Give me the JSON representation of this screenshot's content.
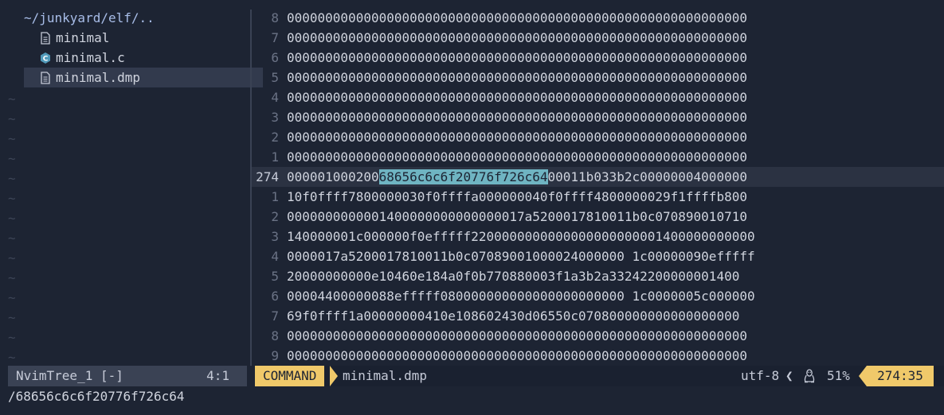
{
  "tree": {
    "root": "~/junkyard/elf/..",
    "items": [
      {
        "label": "minimal",
        "icon": "file-icon"
      },
      {
        "label": "minimal.c",
        "icon": "c-language-icon"
      },
      {
        "label": "minimal.dmp",
        "icon": "file-icon",
        "selected": true
      }
    ],
    "tilde": "~"
  },
  "editor": {
    "lines": [
      {
        "ln": "8",
        "text": "000000000000000000000000000000000000000000000000000000000000"
      },
      {
        "ln": "7",
        "text": "000000000000000000000000000000000000000000000000000000000000"
      },
      {
        "ln": "6",
        "text": "000000000000000000000000000000000000000000000000000000000000"
      },
      {
        "ln": "5",
        "text": "000000000000000000000000000000000000000000000000000000000000"
      },
      {
        "ln": "4",
        "text": "000000000000000000000000000000000000000000000000000000000000"
      },
      {
        "ln": "3",
        "text": "000000000000000000000000000000000000000000000000000000000000"
      },
      {
        "ln": "2",
        "text": "000000000000000000000000000000000000000000000000000000000000"
      },
      {
        "ln": "1",
        "text": "000000000000000000000000000000000000000000000000000000000000"
      },
      {
        "ln": "274",
        "pre": "000001000200",
        "match": "68656c6c6f20776f726c64",
        "post": "00011b033b2c00000004000000",
        "current": true
      },
      {
        "ln": "1",
        "text": "10f0ffff7800000030f0ffffa000000040f0ffff4800000029f1ffffb800"
      },
      {
        "ln": "2",
        "text": "0000000000001400000000000000017a5200017810011b0c070890010710"
      },
      {
        "ln": "3",
        "text": "140000001c000000f0efffff2200000000000000000000001400000000000"
      },
      {
        "ln": "4",
        "text": "0000017a5200017810011b0c07089001000024000000 1c00000090efffff"
      },
      {
        "ln": "5",
        "text": "20000000000e10460e184a0f0b770880003f1a3b2a33242200000001400"
      },
      {
        "ln": "6",
        "text": "00004400000088efffff080000000000000000000000 1c0000005c000000"
      },
      {
        "ln": "7",
        "text": "69f0ffff1a00000000410e108602430d06550c070800000000000000000"
      },
      {
        "ln": "8",
        "text": "000000000000000000000000000000000000000000000000000000000000"
      },
      {
        "ln": "9",
        "text": "000000000000000000000000000000000000000000000000000000000000"
      }
    ]
  },
  "statusbar": {
    "tree_name": "NvimTree_1 [-]",
    "tree_pos": "4:1",
    "mode": "COMMAND",
    "file": "minimal.dmp",
    "encoding": "utf-8",
    "separator": "❮",
    "os_icon": "linux-tux-icon",
    "percent": "51%",
    "position": "274:35"
  },
  "cmdline": "/68656c6c6f20776f726c64"
}
